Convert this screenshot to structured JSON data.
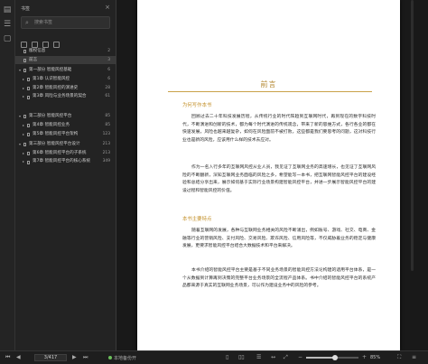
{
  "sidebar": {
    "title": "书签",
    "search_placeholder": "搜索书签",
    "items": [
      {
        "label": "版权信息",
        "page": "2",
        "level": 0,
        "arrow": "",
        "selected": false
      },
      {
        "label": "前言",
        "page": "3",
        "level": 0,
        "arrow": "",
        "selected": true
      },
      {
        "label": "第一部分 智能风控基础",
        "page": "6",
        "level": 0,
        "arrow": "▾",
        "selected": false
      },
      {
        "label": "第1章 认识智能风控",
        "page": "6",
        "level": 1,
        "arrow": "▸",
        "selected": false
      },
      {
        "label": "第2章 智能风控的演进史",
        "page": "28",
        "level": 1,
        "arrow": "▸",
        "selected": false
      },
      {
        "label": "第3章 风险与业务场景的契合",
        "page": "61",
        "level": 1,
        "arrow": "▸",
        "selected": false
      },
      {
        "label": "第二部分 智能风控平台",
        "page": "85",
        "level": 0,
        "arrow": "▾",
        "selected": false
      },
      {
        "label": "第4章 智能风控业务",
        "page": "85",
        "level": 1,
        "arrow": "▸",
        "selected": false
      },
      {
        "label": "第5章 智能风控平台架构",
        "page": "123",
        "level": 1,
        "arrow": "▸",
        "selected": false
      },
      {
        "label": "第三部分 智能风控平台设计",
        "page": "213",
        "level": 0,
        "arrow": "▾",
        "selected": false
      },
      {
        "label": "第6章 智能风控平台的子系统",
        "page": "213",
        "level": 1,
        "arrow": "▸",
        "selected": false
      },
      {
        "label": "第7章 智能风控平台的核心系统",
        "page": "349",
        "level": 1,
        "arrow": "▸",
        "selected": false
      }
    ]
  },
  "status": {
    "page_display": "3/417",
    "sync_label": "本地备份开",
    "zoom": "85%",
    "zoom_fraction": 0.55
  },
  "page": {
    "title": "前言",
    "h_why": "为何写作本书",
    "p1": "回顾过去二十年科技发展历程，从传统行业的时代阵趋到互联网时代，再到现在的数字科技时代，不断演进和创新的技术，都为每个时代演进的传统观念，带来了新的思维方式，各行各业的都在快速发展，风险也越来越复杂，如何在风险面前不被打败，这些都是我们要思考的问题，这对科技行业也是新的风险，应该用什么样的技术去应对。",
    "p2": "作为一名入行多年的互联网风控从业人员，我见证了互联网业务的高速增长，也见证了互联网风险的不断翻新，深知互联网业务面临的风险之多，希望能写一本书，把互联网智能风控平台的建设经验和总结分享出来，展示如何基于实际行业场景构建智能风控平台，并进一步展示智能风控平台的建设过程和智能风控的价值。",
    "h_features": "本书主要特点",
    "p3": "随着互联网的发展，各种与互联网业务相关的风险不断涌出，例如账号、游戏、社交、电商、金融等行业的营销风险、支付风险、交易风险、欺诈风险、信用风险等，不仅威胁着业务的稳定与健康发展，更要求智能风控平台结合大数据技术和平台来解决。",
    "p4": "本书介绍的智能风控平台主要是基于不同业务场景的智能风控方法论构建的适用平台体系，是一个从数据到计算再到决策的完整平台业务场景的全流程产品体系。书中介绍的智能风控平台的系统产品都来源于真实的互联网业务场景，可以作为建设业务中的风险的参考。"
  }
}
